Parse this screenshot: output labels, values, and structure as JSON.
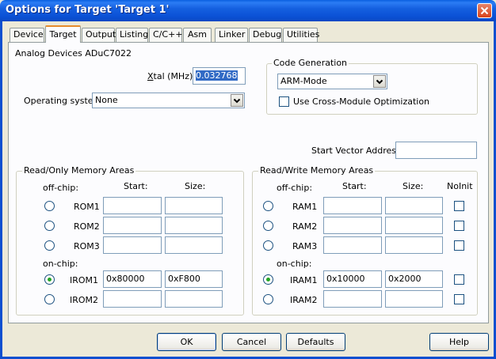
{
  "window": {
    "title": "Options for Target 'Target 1'"
  },
  "tabs": [
    {
      "label": "Device"
    },
    {
      "label": "Target",
      "active": true
    },
    {
      "label": "Output"
    },
    {
      "label": "Listing"
    },
    {
      "label": "C/C++"
    },
    {
      "label": "Asm"
    },
    {
      "label": "Linker"
    },
    {
      "label": "Debug"
    },
    {
      "label": "Utilities"
    }
  ],
  "device_name": "Analog Devices ADuC7022",
  "xtal": {
    "label_u": "X",
    "label_rest": "tal (MHz):",
    "value": "0.032768"
  },
  "os": {
    "label": "Operating system:",
    "value": "None"
  },
  "code_gen": {
    "title": "Code Generation",
    "mode": "ARM-Mode",
    "cross_module_label": "Use Cross-Module Optimization",
    "cross_module_checked": false
  },
  "start_vector": {
    "label": "Start Vector Address:",
    "value": ""
  },
  "rom": {
    "title": "Read/Only Memory Areas",
    "offchip_label": "off-chip:",
    "onchip_label": "on-chip:",
    "start_header": "Start:",
    "size_header": "Size:",
    "rows": [
      {
        "name": "ROM1",
        "start": "",
        "size": "",
        "selected": false
      },
      {
        "name": "ROM2",
        "start": "",
        "size": "",
        "selected": false
      },
      {
        "name": "ROM3",
        "start": "",
        "size": "",
        "selected": false
      },
      {
        "name": "IROM1",
        "start": "0x80000",
        "size": "0xF800",
        "selected": true
      },
      {
        "name": "IROM2",
        "start": "",
        "size": "",
        "selected": false
      }
    ]
  },
  "ram": {
    "title": "Read/Write Memory Areas",
    "offchip_label": "off-chip:",
    "onchip_label": "on-chip:",
    "start_header": "Start:",
    "size_header": "Size:",
    "noinit_header": "NoInit",
    "rows": [
      {
        "name": "RAM1",
        "start": "",
        "size": "",
        "selected": false,
        "noinit": false
      },
      {
        "name": "RAM2",
        "start": "",
        "size": "",
        "selected": false,
        "noinit": false
      },
      {
        "name": "RAM3",
        "start": "",
        "size": "",
        "selected": false,
        "noinit": false
      },
      {
        "name": "IRAM1",
        "start": "0x10000",
        "size": "0x2000",
        "selected": true,
        "noinit": false
      },
      {
        "name": "IRAM2",
        "start": "",
        "size": "",
        "selected": false,
        "noinit": false
      }
    ]
  },
  "buttons": {
    "ok": "OK",
    "cancel": "Cancel",
    "defaults": "Defaults",
    "help": "Help"
  },
  "colors": {
    "title_bar": "#0b52d6",
    "dialog_bg": "#ece9d8",
    "panel_bg": "#fcfcfe",
    "selection": "#316ac5",
    "radio_dot": "#24a524",
    "tab_highlight": "#e68b2c"
  }
}
